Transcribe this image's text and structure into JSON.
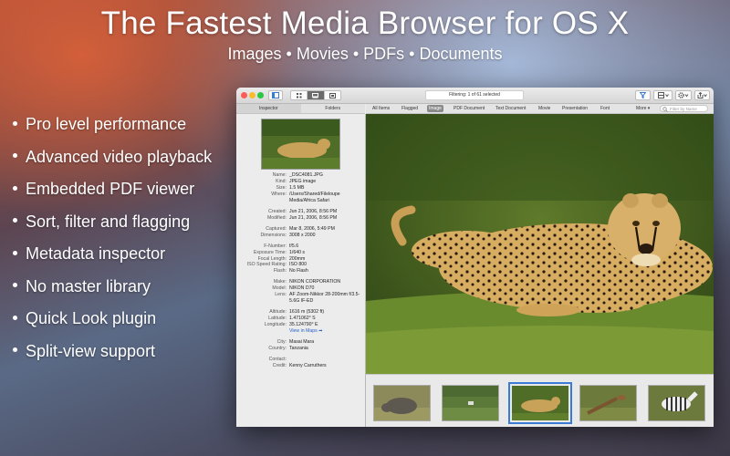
{
  "hero": {
    "title": "The Fastest Media Browser for OS X",
    "subtitle": "Images • Movies • PDFs • Documents"
  },
  "features": [
    "Pro level performance",
    "Advanced video playback",
    "Embedded PDF viewer",
    "Sort, filter and flagging",
    "Metadata inspector",
    "No master library",
    "Quick Look plugin",
    "Split-view support"
  ],
  "window": {
    "status": "Filtering: 1 of 61 selected",
    "left_tabs": [
      "Inspector",
      "Folders"
    ],
    "filter_tabs": [
      "All Items",
      "Flagged",
      "Image",
      "PDF Document",
      "Text Document",
      "Movie",
      "Presentation",
      "Font"
    ],
    "selected_filter": "Image",
    "more_label": "More ▾",
    "search_placeholder": "Filter by Name",
    "icons": [
      "sidebar-toggle-icon",
      "grid-view-icon",
      "filmstrip-view-icon",
      "single-view-icon",
      "filter-funnel-icon",
      "view-options-icon",
      "gear-icon",
      "share-icon"
    ]
  },
  "inspector": {
    "name_label": "Name:",
    "name": "_DSC4081.JPG",
    "kind_label": "Kind:",
    "kind": "JPEG image",
    "size_label": "Size:",
    "size": "1.5 MB",
    "where_label": "Where:",
    "where": "/Users/Shared/Fileloupe Media/Africa Safari",
    "created_label": "Created:",
    "created": "Jun 21, 2006, 8:56 PM",
    "modified_label": "Modified:",
    "modified": "Jun 21, 2006, 8:56 PM",
    "captured_label": "Captured:",
    "captured": "Mar 8, 2006, 5:49 PM",
    "dimensions_label": "Dimensions:",
    "dimensions": "3008 x 2000",
    "fnumber_label": "F-Number:",
    "fnumber": "f/5.6",
    "exposure_label": "Exposure Time:",
    "exposure": "1/640 s",
    "focal_label": "Focal Length:",
    "focal": "200mm",
    "iso_label": "ISO Speed Rating:",
    "iso": "ISO 800",
    "flash_label": "Flash:",
    "flash": "No Flash",
    "make_label": "Make:",
    "make": "NIKON CORPORATION",
    "model_label": "Model:",
    "model": "NIKON D70",
    "lens_label": "Lens:",
    "lens": "AF Zoom-Nikkor 28-200mm f/3.5-5.6G IF-ED",
    "altitude_label": "Altitude:",
    "altitude": "1616 m (5302 ft)",
    "latitude_label": "Latitude:",
    "latitude": "1.471062° S",
    "longitude_label": "Longitude:",
    "longitude": "35.124790° E",
    "maps_link": "View in Maps ➡",
    "city_label": "City:",
    "city": "Masai Mara",
    "country_label": "Country:",
    "country": "Tanzania",
    "contact_label": "Contact:",
    "contact": "",
    "credit_label": "Credit:",
    "credit": "Kenny Carruthers"
  },
  "thumbnails": [
    "rhino",
    "zebra on savanna",
    "cheetah",
    "giraffe",
    "zebra"
  ],
  "selected_thumbnail_index": 2,
  "colors": {
    "accent": "#3a7bd5",
    "close": "#fc5d57",
    "minimize": "#fdbc2e",
    "zoom": "#28c840"
  }
}
